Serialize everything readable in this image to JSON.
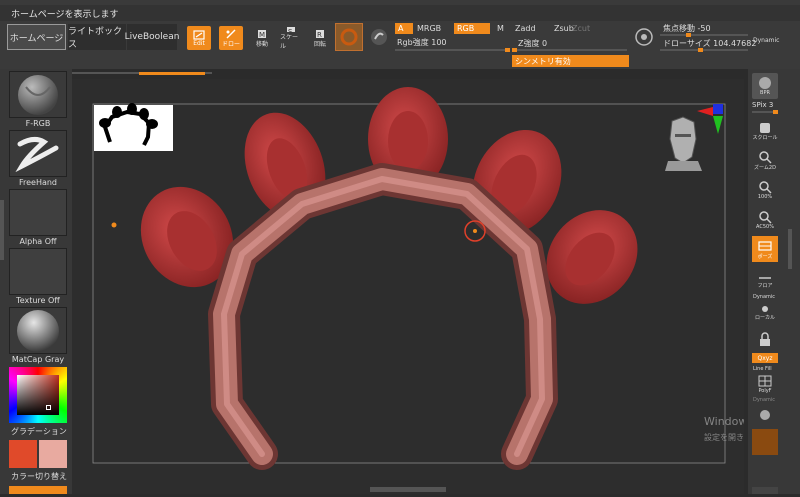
{
  "menu": {
    "home_hint": "ホームページを表示します"
  },
  "toolbar": {
    "home_button": "ホームページ",
    "lightbox_button": "ライトボックス",
    "liveboolean_button": "LiveBoolean",
    "edit_label": "Edit",
    "draw_label": "ドロー",
    "move_label": "移動",
    "scale_label": "スケール",
    "rotate_label": "回転",
    "a_tag": "A",
    "mrgb_tag": "MRGB",
    "rgb_tag": "RGB",
    "m_tag": "M",
    "zadd_tag": "Zadd",
    "zsub_tag": "Zsub",
    "zcut_tag": "Zcut",
    "rgb_intensity": "Rgb強度 100",
    "z_intensity": "Z強度 0",
    "focal_shift": "焦点移動 -50",
    "draw_size": "ドローサイズ 104.47682",
    "dynamic_label": "Dynamic",
    "symmetry_label": "シンメトリ有効"
  },
  "left_panel": {
    "brush_label": "F-RGB",
    "stroke_label": "FreeHand",
    "alpha_label": "Alpha Off",
    "texture_label": "Texture Off",
    "material_label": "MatCap Gray",
    "gradient_label": "グラデーション",
    "swap_label": "カラー切り替え",
    "colors": {
      "primary": "#e04a2a",
      "secondary": "#e8aaa0"
    }
  },
  "right_panel": {
    "bpr_label": "BPR",
    "spix_label": "SPix 3",
    "scroll_label": "スクロール",
    "zoom_label": "ズーム2D",
    "actual_label": "100%",
    "ac50_label": "AC50%",
    "pose_label": "ポーズ",
    "floor_label": "フロア",
    "local_label": "ローカル",
    "dynamic_label": "Dynamic",
    "xyz_label": "Qxyz",
    "linefill_label": "Line Fill",
    "polyf_label": "PolyF",
    "dynamic2_label": "Dynamic"
  },
  "watermark": {
    "line1": "Windows のライセン",
    "line2": "設定を開き、Windows の"
  },
  "colors": {
    "accent": "#f08a1c",
    "model": "#b86a63",
    "ear": "#c23d3d"
  }
}
